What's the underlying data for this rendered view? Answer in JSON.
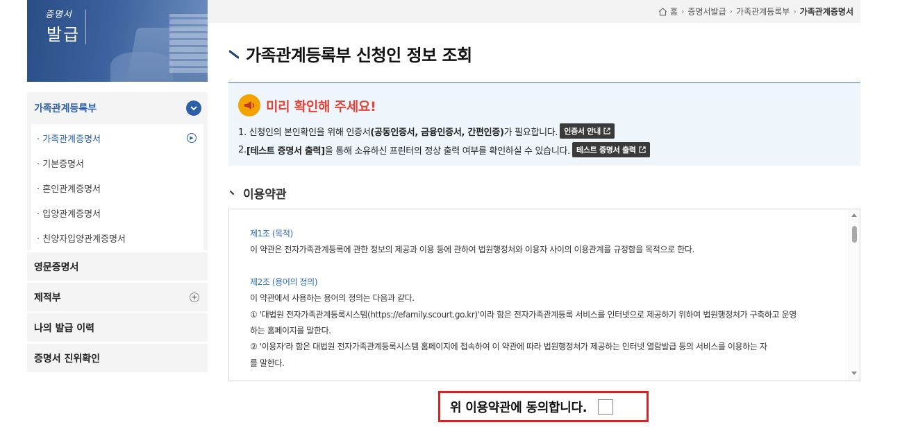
{
  "banner": {
    "small_text": "증명서",
    "big_text": "발급"
  },
  "sidebar": {
    "section_title": "가족관계등록부",
    "sub_items": [
      {
        "label": "· 가족관계증명서",
        "active": true
      },
      {
        "label": "· 기본증명서",
        "active": false
      },
      {
        "label": "· 혼인관계증명서",
        "active": false
      },
      {
        "label": "· 입양관계증명서",
        "active": false
      },
      {
        "label": "· 친양자입양관계증명서",
        "active": false
      }
    ],
    "other_items": [
      {
        "label": "영문증명서",
        "expandable": false
      },
      {
        "label": "제적부",
        "expandable": true
      },
      {
        "label": "나의 발급 이력",
        "expandable": false
      },
      {
        "label": "증명서 진위확인",
        "expandable": false
      }
    ]
  },
  "breadcrumb": {
    "home": "홈",
    "items": [
      "증명서발급",
      "가족관계등록부"
    ],
    "current": "가족관계증명서"
  },
  "page_title": "가족관계등록부 신청인 정보 조회",
  "notice": {
    "title": "미리 확인해 주세요!",
    "line1_prefix": "1. 신청인의 본인확인을 위해 인증서",
    "line1_bold": "(공동인증서, 금융인증서, 간편인증)",
    "line1_suffix": "가 필요합니다.",
    "line1_button": "인증서 안내",
    "line2_prefix": "2. ",
    "line2_bold": "[테스트 증명서 출력]",
    "line2_suffix": "을 통해 소유하신 프린터의 정상 출력 여부를 확인하실 수 있습니다.",
    "line2_button": "테스트 증명서 출력"
  },
  "terms": {
    "heading": "이용약관",
    "article1_title": "제1조 (목적)",
    "article1_body": "이 약관은 전자가족관계등록에 관한 정보의 제공과 이용 등에 관하여 법원행정처와 이용자 사이의 이용관계를 규정함을 목적으로 한다.",
    "article2_title": "제2조 (용어의 정의)",
    "article2_intro": "이 약관에서 사용하는 용어의 정의는 다음과 같다.",
    "article2_item1_a": "① '대법원 전자가족관계등록시스템(https://efamily.scourt.go.kr)'이라 함은 전자가족관계등록 서비스를 인터넷으로 제공하기 위하여 법원행정처가 구축하고 운영",
    "article2_item1_b": "하는 홈페이지를 말한다.",
    "article2_item2_a": "② '이용자'라 함은 대법원 전자가족관계등록시스템 홈페이지에 접속하여 이 약관에 따라 법원행정처가 제공하는 인터넷 열람발급 등의 서비스를 이용하는 자",
    "article2_item2_b": "를 말한다."
  },
  "agree": {
    "label": "위 이용약관에 동의합니다."
  },
  "colors": {
    "brand_blue": "#2b5fa8",
    "notice_red": "#e0453a",
    "highlight_red": "#e02020",
    "megaphone_orange": "#f2a300"
  }
}
